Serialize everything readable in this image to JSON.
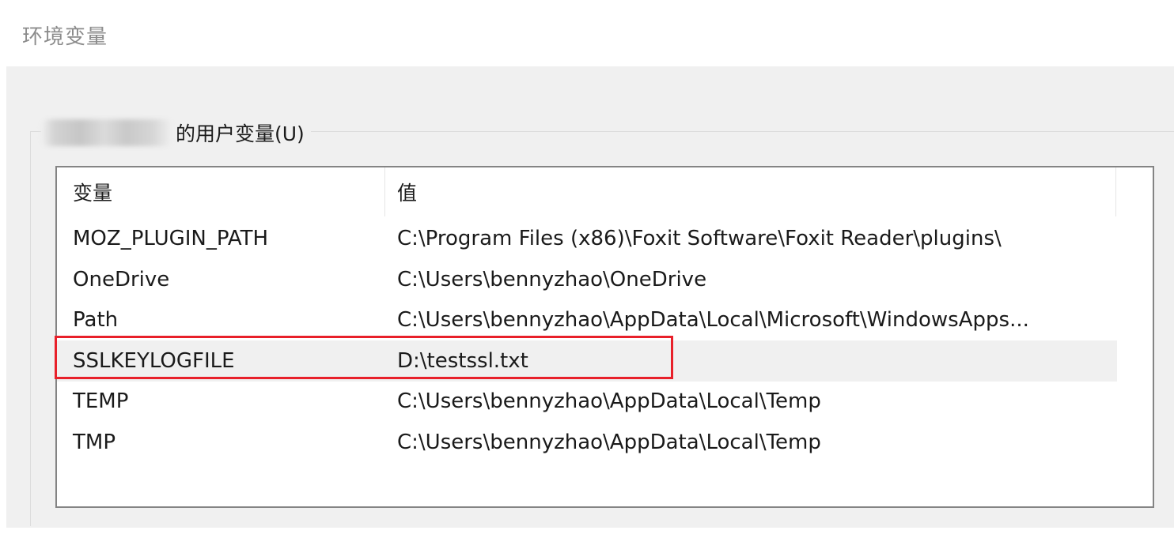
{
  "window": {
    "title": "环境变量"
  },
  "user_vars_group": {
    "label": "的用户变量(U)"
  },
  "columns": {
    "variable": "变量",
    "value": "值"
  },
  "rows": [
    {
      "name": "MOZ_PLUGIN_PATH",
      "value": "C:\\Program Files (x86)\\Foxit Software\\Foxit Reader\\plugins\\"
    },
    {
      "name": "OneDrive",
      "value": "C:\\Users\\bennyzhao\\OneDrive"
    },
    {
      "name": "Path",
      "value": "C:\\Users\\bennyzhao\\AppData\\Local\\Microsoft\\WindowsApps..."
    },
    {
      "name": "SSLKEYLOGFILE",
      "value": "D:\\testssl.txt"
    },
    {
      "name": "TEMP",
      "value": "C:\\Users\\bennyzhao\\AppData\\Local\\Temp"
    },
    {
      "name": "TMP",
      "value": "C:\\Users\\bennyzhao\\AppData\\Local\\Temp"
    }
  ],
  "selected_row": "SSLKEYLOGFILE",
  "colors": {
    "highlight_border": "#e8202a",
    "selected_row_bg": "#f0f0f0",
    "list_border": "#848484"
  }
}
